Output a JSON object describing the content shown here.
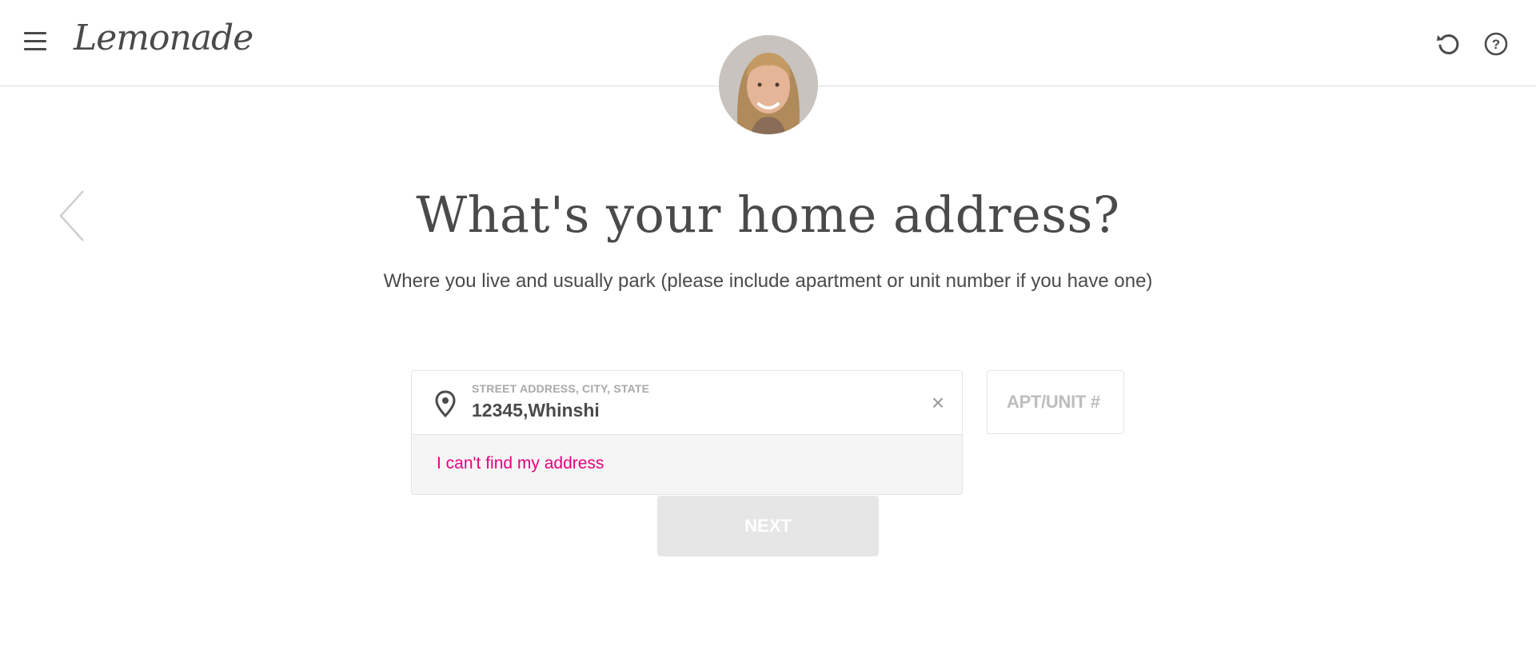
{
  "header": {
    "brand": "Lemonade",
    "menu_icon": "hamburger-menu-icon",
    "restart_icon": "restart-icon",
    "help_icon": "help-icon"
  },
  "agent": {
    "avatar": "agent-avatar"
  },
  "question": {
    "title": "What's your home address?",
    "subtitle": "Where you live and usually park (please include apartment or unit number if you have one)"
  },
  "address_field": {
    "label": "STREET ADDRESS, CITY, STATE",
    "value": "12345,Whinshi",
    "icon": "location-pin-icon",
    "clear_symbol": "×"
  },
  "suggestions": {
    "cant_find": "I can't find my address"
  },
  "apt_field": {
    "placeholder": "APT/UNIT #"
  },
  "actions": {
    "next_label": "NEXT"
  },
  "colors": {
    "accent": "#e6007e",
    "text": "#4a4a4a",
    "disabled_button": "#e6e6e6"
  }
}
